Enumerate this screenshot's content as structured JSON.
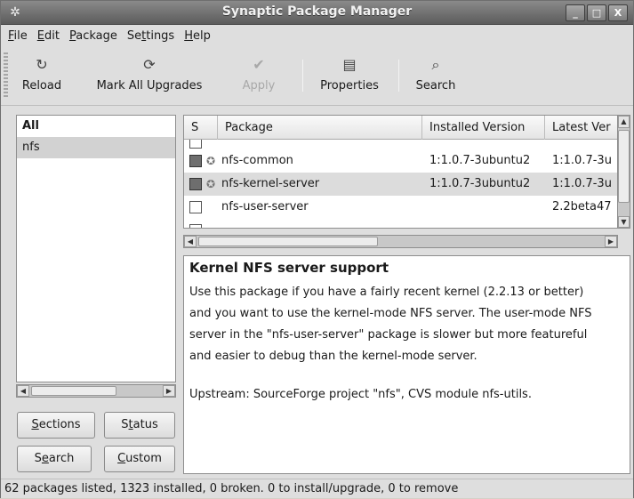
{
  "window": {
    "title": "Synaptic Package Manager",
    "controls": [
      "_",
      "□",
      "X"
    ]
  },
  "menu": [
    {
      "pre": "",
      "ul": "F",
      "post": "ile"
    },
    {
      "pre": "",
      "ul": "E",
      "post": "dit"
    },
    {
      "pre": "",
      "ul": "P",
      "post": "ackage"
    },
    {
      "pre": "Se",
      "ul": "t",
      "post": "tings"
    },
    {
      "pre": "",
      "ul": "H",
      "post": "elp"
    }
  ],
  "toolbar": {
    "reload": "Reload",
    "mark_all": "Mark All Upgrades",
    "apply": "Apply",
    "properties": "Properties",
    "search": "Search"
  },
  "left": {
    "items": [
      "All",
      "nfs"
    ]
  },
  "buttons": {
    "sections": {
      "pre": "",
      "ul": "S",
      "post": "ections"
    },
    "status": {
      "pre": "S",
      "ul": "t",
      "post": "atus"
    },
    "search": {
      "pre": "S",
      "ul": "e",
      "post": "arch"
    },
    "custom": {
      "pre": "",
      "ul": "C",
      "post": "ustom"
    }
  },
  "table": {
    "columns": [
      "S",
      "Package",
      "Installed Version",
      "Latest Ver"
    ],
    "rows": [
      {
        "name": "nfs-common",
        "installed": "1:1.0.7-3ubuntu2",
        "latest": "1:1.0.7-3u"
      },
      {
        "name": "nfs-kernel-server",
        "installed": "1:1.0.7-3ubuntu2",
        "latest": "1:1.0.7-3u"
      },
      {
        "name": "nfs-user-server",
        "installed": "",
        "latest": "2.2beta47"
      }
    ]
  },
  "description": {
    "title": "Kernel NFS server support",
    "lines": [
      "Use this package if you have a fairly recent kernel (2.2.13 or better)",
      "and you want to use the kernel-mode NFS server.  The user-mode NFS",
      "server in the \"nfs-user-server\" package is slower but more featureful",
      "and easier to debug than the kernel-mode server.",
      "Upstream: SourceForge project \"nfs\", CVS module nfs-utils."
    ]
  },
  "status": "62 packages listed, 1323 installed, 0 broken. 0 to install/upgrade, 0 to remove",
  "icons": {
    "reload": "reload-icon",
    "mark_all": "mark-all-icon",
    "apply": "apply-icon",
    "properties": "properties-icon",
    "search": "search-icon"
  }
}
